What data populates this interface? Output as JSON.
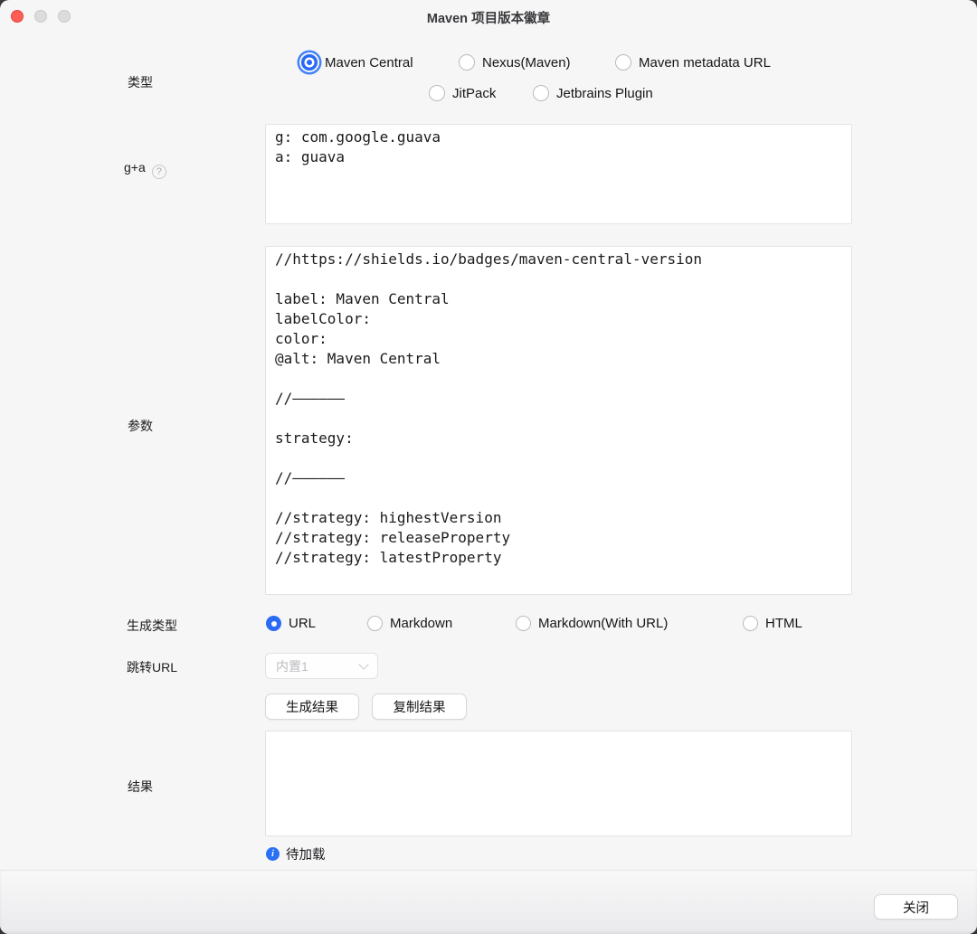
{
  "window": {
    "title": "Maven 项目版本徽章"
  },
  "form": {
    "type": {
      "label": "类型",
      "options": [
        {
          "label": "Maven Central",
          "selected": true
        },
        {
          "label": "Nexus(Maven)",
          "selected": false
        },
        {
          "label": "Maven metadata URL",
          "selected": false
        },
        {
          "label": "JitPack",
          "selected": false
        },
        {
          "label": "Jetbrains Plugin",
          "selected": false
        }
      ]
    },
    "ga": {
      "label": "g+a",
      "help_icon": "?",
      "value": "g: com.google.guava\na: guava"
    },
    "params": {
      "label": "参数",
      "value": "//https://shields.io/badges/maven-central-version\n\nlabel: Maven Central\nlabelColor:\ncolor:\n@alt: Maven Central\n\n//——————\n\nstrategy:\n\n//——————\n\n//strategy: highestVersion\n//strategy: releaseProperty\n//strategy: latestProperty"
    },
    "gen_type": {
      "label": "生成类型",
      "options": [
        {
          "label": "URL",
          "selected": true
        },
        {
          "label": "Markdown",
          "selected": false
        },
        {
          "label": "Markdown(With URL)",
          "selected": false
        },
        {
          "label": "HTML",
          "selected": false
        }
      ]
    },
    "jump_url": {
      "label": "跳转URL",
      "selected_option": "内置1",
      "disabled": true
    },
    "actions": {
      "generate": "生成结果",
      "copy": "复制结果"
    },
    "result": {
      "label": "结果",
      "value": ""
    },
    "status": {
      "icon": "i",
      "text": "待加载"
    }
  },
  "footer": {
    "close": "关闭"
  },
  "colors": {
    "accent": "#2a6af5",
    "info": "#2a70f5",
    "close_light": "#ff5d55",
    "background": "#f6f6f7"
  }
}
